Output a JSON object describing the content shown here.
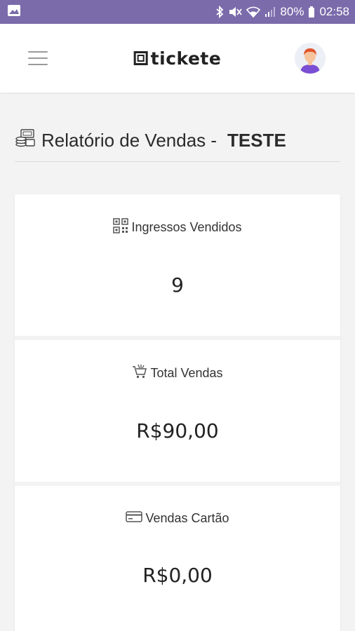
{
  "status_bar": {
    "battery": "80%",
    "time": "02:58"
  },
  "header": {
    "logo_text": "tickete"
  },
  "report": {
    "title_prefix": "Relatório de Vendas -",
    "event_name": "TESTE"
  },
  "stats": [
    {
      "label": "Ingressos Vendidos",
      "value": "9",
      "icon": "qr-code-icon"
    },
    {
      "label": "Total Vendas",
      "value": "R$90,00",
      "icon": "cart-icon"
    },
    {
      "label": "Vendas Cartão",
      "value": "R$0,00",
      "icon": "credit-card-icon"
    }
  ],
  "colors": {
    "status_bar": "#7b6bab",
    "background": "#f3f3f4"
  }
}
